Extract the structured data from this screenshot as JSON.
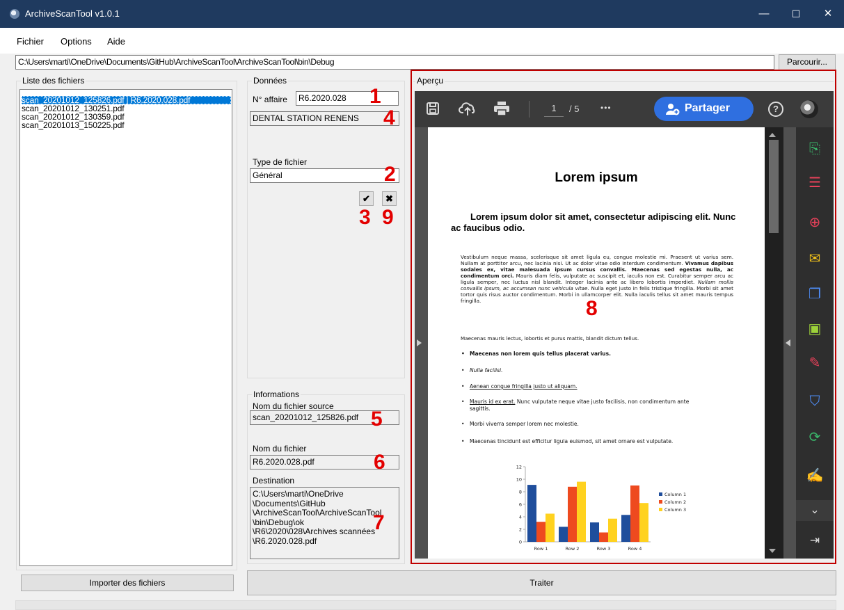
{
  "window": {
    "title": "ArchiveScanTool v1.0.1",
    "minimize": "—",
    "maximize": "☐",
    "close": "✕"
  },
  "menu": [
    "Fichier",
    "Options",
    "Aide"
  ],
  "path": {
    "value": "C:\\Users\\marti\\OneDrive\\Documents\\GitHub\\ArchiveScanTool\\ArchiveScanTool\\bin\\Debug",
    "browse_label": "Parcourir..."
  },
  "files": {
    "group_label": "Liste des fichiers",
    "items": [
      "scan_20201012_125826.pdf | R6.2020.028.pdf",
      "scan_20201012_130251.pdf",
      "scan_20201012_130359.pdf",
      "scan_20201013_150225.pdf"
    ],
    "import_label": "Importer des fichiers"
  },
  "donnees": {
    "group_label": "Données",
    "affaire_label": "N° affaire",
    "affaire_value": "R6.2020.028",
    "client_value": "DENTAL STATION RENENS",
    "type_label": "Type de fichier",
    "type_value": "Général",
    "ok_icon": "✔",
    "cancel_icon": "✖"
  },
  "informations": {
    "group_label": "Informations",
    "source_label": "Nom du fichier source",
    "source_value": "scan_20201012_125826.pdf",
    "filename_label": "Nom du fichier",
    "filename_value": "R6.2020.028.pdf",
    "dest_label": "Destination",
    "dest_lines": [
      "C:\\Users\\marti\\OneDrive",
      "\\Documents\\GitHub",
      "\\ArchiveScanTool\\ArchiveScanTool",
      "\\bin\\Debug\\ok",
      "\\R6\\2020\\028\\Archives scannées",
      "\\R6.2020.028.pdf"
    ]
  },
  "process_label": "Traiter",
  "annotations": {
    "n1": "1",
    "n2": "2",
    "n3": "3",
    "n4": "4",
    "n5": "5",
    "n6": "6",
    "n7": "7",
    "n8": "8",
    "n9": "9"
  },
  "preview": {
    "group_label": "Aperçu",
    "page_current": "1",
    "page_total": "/ 5",
    "more": "•••",
    "share_label": "Partager",
    "help": "?",
    "doc": {
      "title": "Lorem ipsum",
      "subtitle": "Lorem ipsum dolor sit amet, consectetur adipiscing elit. Nunc ac faucibus odio.",
      "para1_a": "Vestibulum neque massa, scelerisque sit amet ligula eu, congue molestie mi. Praesent ut varius sem. Nullam at porttitor arcu, nec lacinia nisi. Ut ac dolor vitae odio interdum condimentum. ",
      "para1_b": "Vivamus dapibus sodales ex, vitae malesuada ipsum cursus convallis. Maecenas sed egestas nulla, ac condimentum orci.",
      "para1_c": " Mauris diam felis, vulputate ac suscipit et, iaculis non est. Curabitur semper arcu ac ligula semper, nec luctus nisl blandit. Integer lacinia ante ac libero lobortis imperdiet. ",
      "para1_d": "Nullam mollis convallis ipsum, ac accumsan nunc vehicula vitae.",
      "para1_e": " Nulla eget justo in felis tristique fringilla. Morbi sit amet tortor quis risus auctor condimentum. Morbi in ullamcorper elit. Nulla iaculis tellus sit amet mauris tempus fringilla.",
      "para2": "Maecenas mauris lectus, lobortis et purus mattis, blandit dictum tellus.",
      "bullets": [
        "Maecenas non lorem quis tellus placerat varius.",
        "Nulla facilisi.",
        "Aenean congue fringilla justo ut aliquam.",
        "Mauris id ex erat.",
        "Morbi viverra semper lorem nec molestie.",
        "Maecenas tincidunt est efficitur ligula euismod, sit amet ornare est vulputate."
      ],
      "bullet4_rest": " Nunc vulputate neque vitae justo facilisis, non condimentum ante",
      "bullet4_cont": "sagittis."
    }
  },
  "colors": {
    "accent": "#0078d7",
    "share": "#2f6fe0",
    "annotation": "#e30000",
    "frame": "#c00000",
    "series1": "#1f4e9c",
    "series2": "#ee4a1f",
    "series3": "#ffd21f"
  },
  "chart_data": {
    "type": "bar",
    "categories": [
      "Row 1",
      "Row 2",
      "Row 3",
      "Row 4"
    ],
    "series": [
      {
        "name": "Column 1",
        "values": [
          9.1,
          2.4,
          3.1,
          4.3
        ]
      },
      {
        "name": "Column 2",
        "values": [
          3.2,
          8.8,
          1.5,
          9.0
        ]
      },
      {
        "name": "Column 3",
        "values": [
          4.5,
          9.6,
          3.7,
          6.2
        ]
      }
    ],
    "ylim": [
      0,
      12
    ],
    "yticks": [
      0,
      2,
      4,
      6,
      8,
      10,
      12
    ],
    "legend": "right",
    "grid": false
  }
}
